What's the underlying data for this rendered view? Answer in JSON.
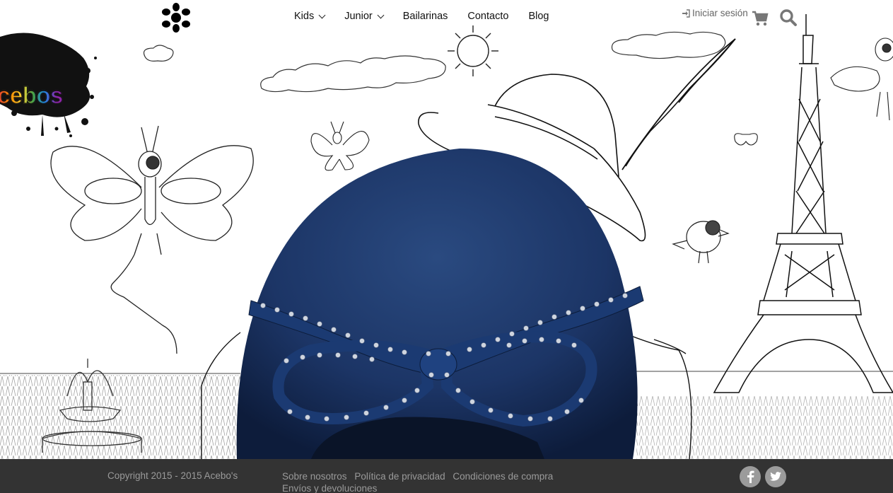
{
  "brand": {
    "splash_word": "cebos",
    "logo_icon": "asterisk-flower-logo"
  },
  "nav": {
    "items": [
      {
        "label": "Kids",
        "has_dropdown": true
      },
      {
        "label": "Junior",
        "has_dropdown": true
      },
      {
        "label": "Bailarinas",
        "has_dropdown": false
      },
      {
        "label": "Contacto",
        "has_dropdown": false
      },
      {
        "label": "Blog",
        "has_dropdown": false
      }
    ],
    "login_label": "Iniciar sesión",
    "login_icon": "sign-in-icon",
    "cart_icon": "shopping-cart-icon",
    "search_icon": "search-icon"
  },
  "footer": {
    "copyright": "Copyright 2015 - 2015 Acebo's",
    "links": [
      "Sobre nosotros",
      "Política de privacidad",
      "Condiciones de compra",
      "Envíos y devoluciones"
    ],
    "social": [
      {
        "name": "facebook-icon",
        "glyph": "f"
      },
      {
        "name": "twitter-icon"
      }
    ],
    "background": "#333333",
    "text_color": "#9a9a9a"
  },
  "colors": {
    "shoe_blue": "#1c3566",
    "nav_text": "#111111"
  }
}
